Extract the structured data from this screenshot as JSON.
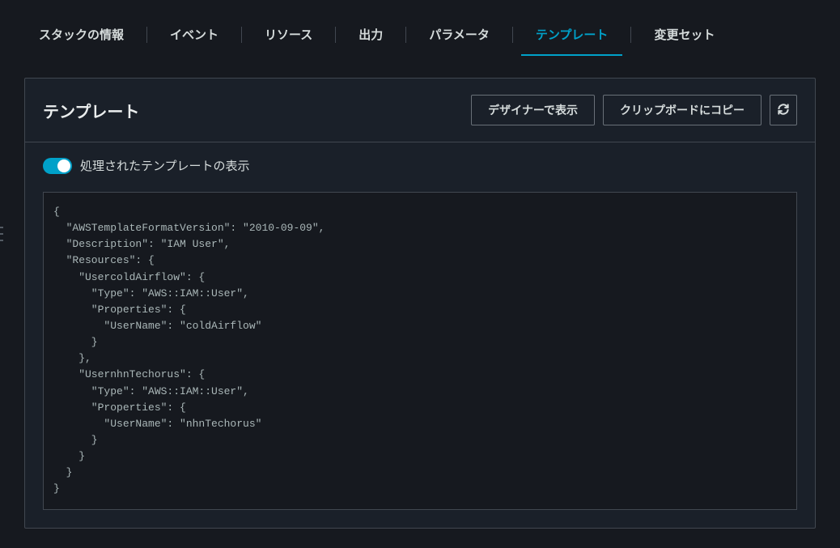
{
  "tabs": [
    {
      "label": "スタックの情報",
      "active": false
    },
    {
      "label": "イベント",
      "active": false
    },
    {
      "label": "リソース",
      "active": false
    },
    {
      "label": "出力",
      "active": false
    },
    {
      "label": "パラメータ",
      "active": false
    },
    {
      "label": "テンプレート",
      "active": true
    },
    {
      "label": "変更セット",
      "active": false
    }
  ],
  "panel": {
    "title": "テンプレート",
    "view_in_designer": "デザイナーで表示",
    "copy_clipboard": "クリップボードにコピー"
  },
  "toggle": {
    "label": "処理されたテンプレートの表示",
    "on": true
  },
  "template_code": "{\n  \"AWSTemplateFormatVersion\": \"2010-09-09\",\n  \"Description\": \"IAM User\",\n  \"Resources\": {\n    \"UsercoldAirflow\": {\n      \"Type\": \"AWS::IAM::User\",\n      \"Properties\": {\n        \"UserName\": \"coldAirflow\"\n      }\n    },\n    \"UsernhnTechorus\": {\n      \"Type\": \"AWS::IAM::User\",\n      \"Properties\": {\n        \"UserName\": \"nhnTechorus\"\n      }\n    }\n  }\n}"
}
